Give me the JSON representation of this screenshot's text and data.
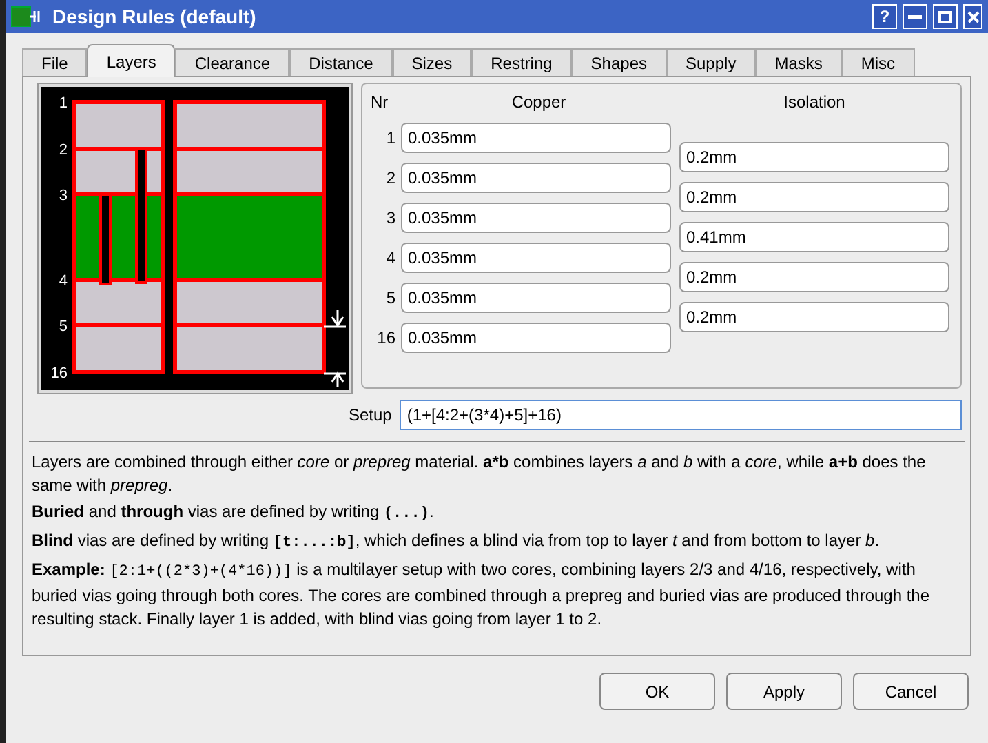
{
  "window": {
    "title": "Design Rules (default)",
    "controls": [
      "?"
    ]
  },
  "tabs": [
    {
      "label": "File",
      "selected": false
    },
    {
      "label": "Layers",
      "selected": true
    },
    {
      "label": "Clearance",
      "selected": false
    },
    {
      "label": "Distance",
      "selected": false
    },
    {
      "label": "Sizes",
      "selected": false
    },
    {
      "label": "Restring",
      "selected": false
    },
    {
      "label": "Shapes",
      "selected": false
    },
    {
      "label": "Supply",
      "selected": false
    },
    {
      "label": "Masks",
      "selected": false
    },
    {
      "label": "Misc",
      "selected": false
    }
  ],
  "stackup_labels": [
    "1",
    "2",
    "3",
    "4",
    "5",
    "16"
  ],
  "table": {
    "columns": [
      "Nr",
      "Copper",
      "Isolation"
    ],
    "copper": [
      {
        "nr": "1",
        "value": "0.035mm"
      },
      {
        "nr": "2",
        "value": "0.035mm"
      },
      {
        "nr": "3",
        "value": "0.035mm"
      },
      {
        "nr": "4",
        "value": "0.035mm"
      },
      {
        "nr": "5",
        "value": "0.035mm"
      },
      {
        "nr": "16",
        "value": "0.035mm"
      }
    ],
    "isolation": [
      "0.2mm",
      "0.2mm",
      "0.41mm",
      "0.2mm",
      "0.2mm"
    ]
  },
  "setup": {
    "label": "Setup",
    "value": "(1+[4:2+(3*4)+5]+16)"
  },
  "help": [
    [
      {
        "kind": "text",
        "text": "Layers are combined through either *core* or *prepreg* material. **a*b** combines layers *a* and *b* with a *core*, while **a+b** does the same with *prepreg*."
      }
    ],
    [
      {
        "kind": "text",
        "text": "**Buried** and **through** vias are defined by writing "
      },
      {
        "kind": "code",
        "text": "**(...)**"
      },
      {
        "kind": "text",
        "text": "."
      }
    ],
    [
      {
        "kind": "text",
        "text": "**Blind** vias are defined by writing "
      },
      {
        "kind": "code",
        "text": "**[t:...:b]**"
      },
      {
        "kind": "text",
        "text": ", which defines a blind via from top to layer *t* and from bottom to layer *b*."
      }
    ],
    [
      {
        "kind": "text",
        "text": "**Example:** "
      },
      {
        "kind": "code",
        "text": "[2:1+((2*3)+(4*16))]"
      },
      {
        "kind": "text",
        "text": " is a multilayer setup with two cores, combining layers 2/3 and 4/16, respectively, with buried vias going through both cores. The cores are combined through a prepreg and buried vias are produced through the resulting stack. Finally layer 1 is added, with blind vias going from layer 1 to 2."
      }
    ]
  ],
  "buttons": [
    "OK",
    "Apply",
    "Cancel"
  ]
}
